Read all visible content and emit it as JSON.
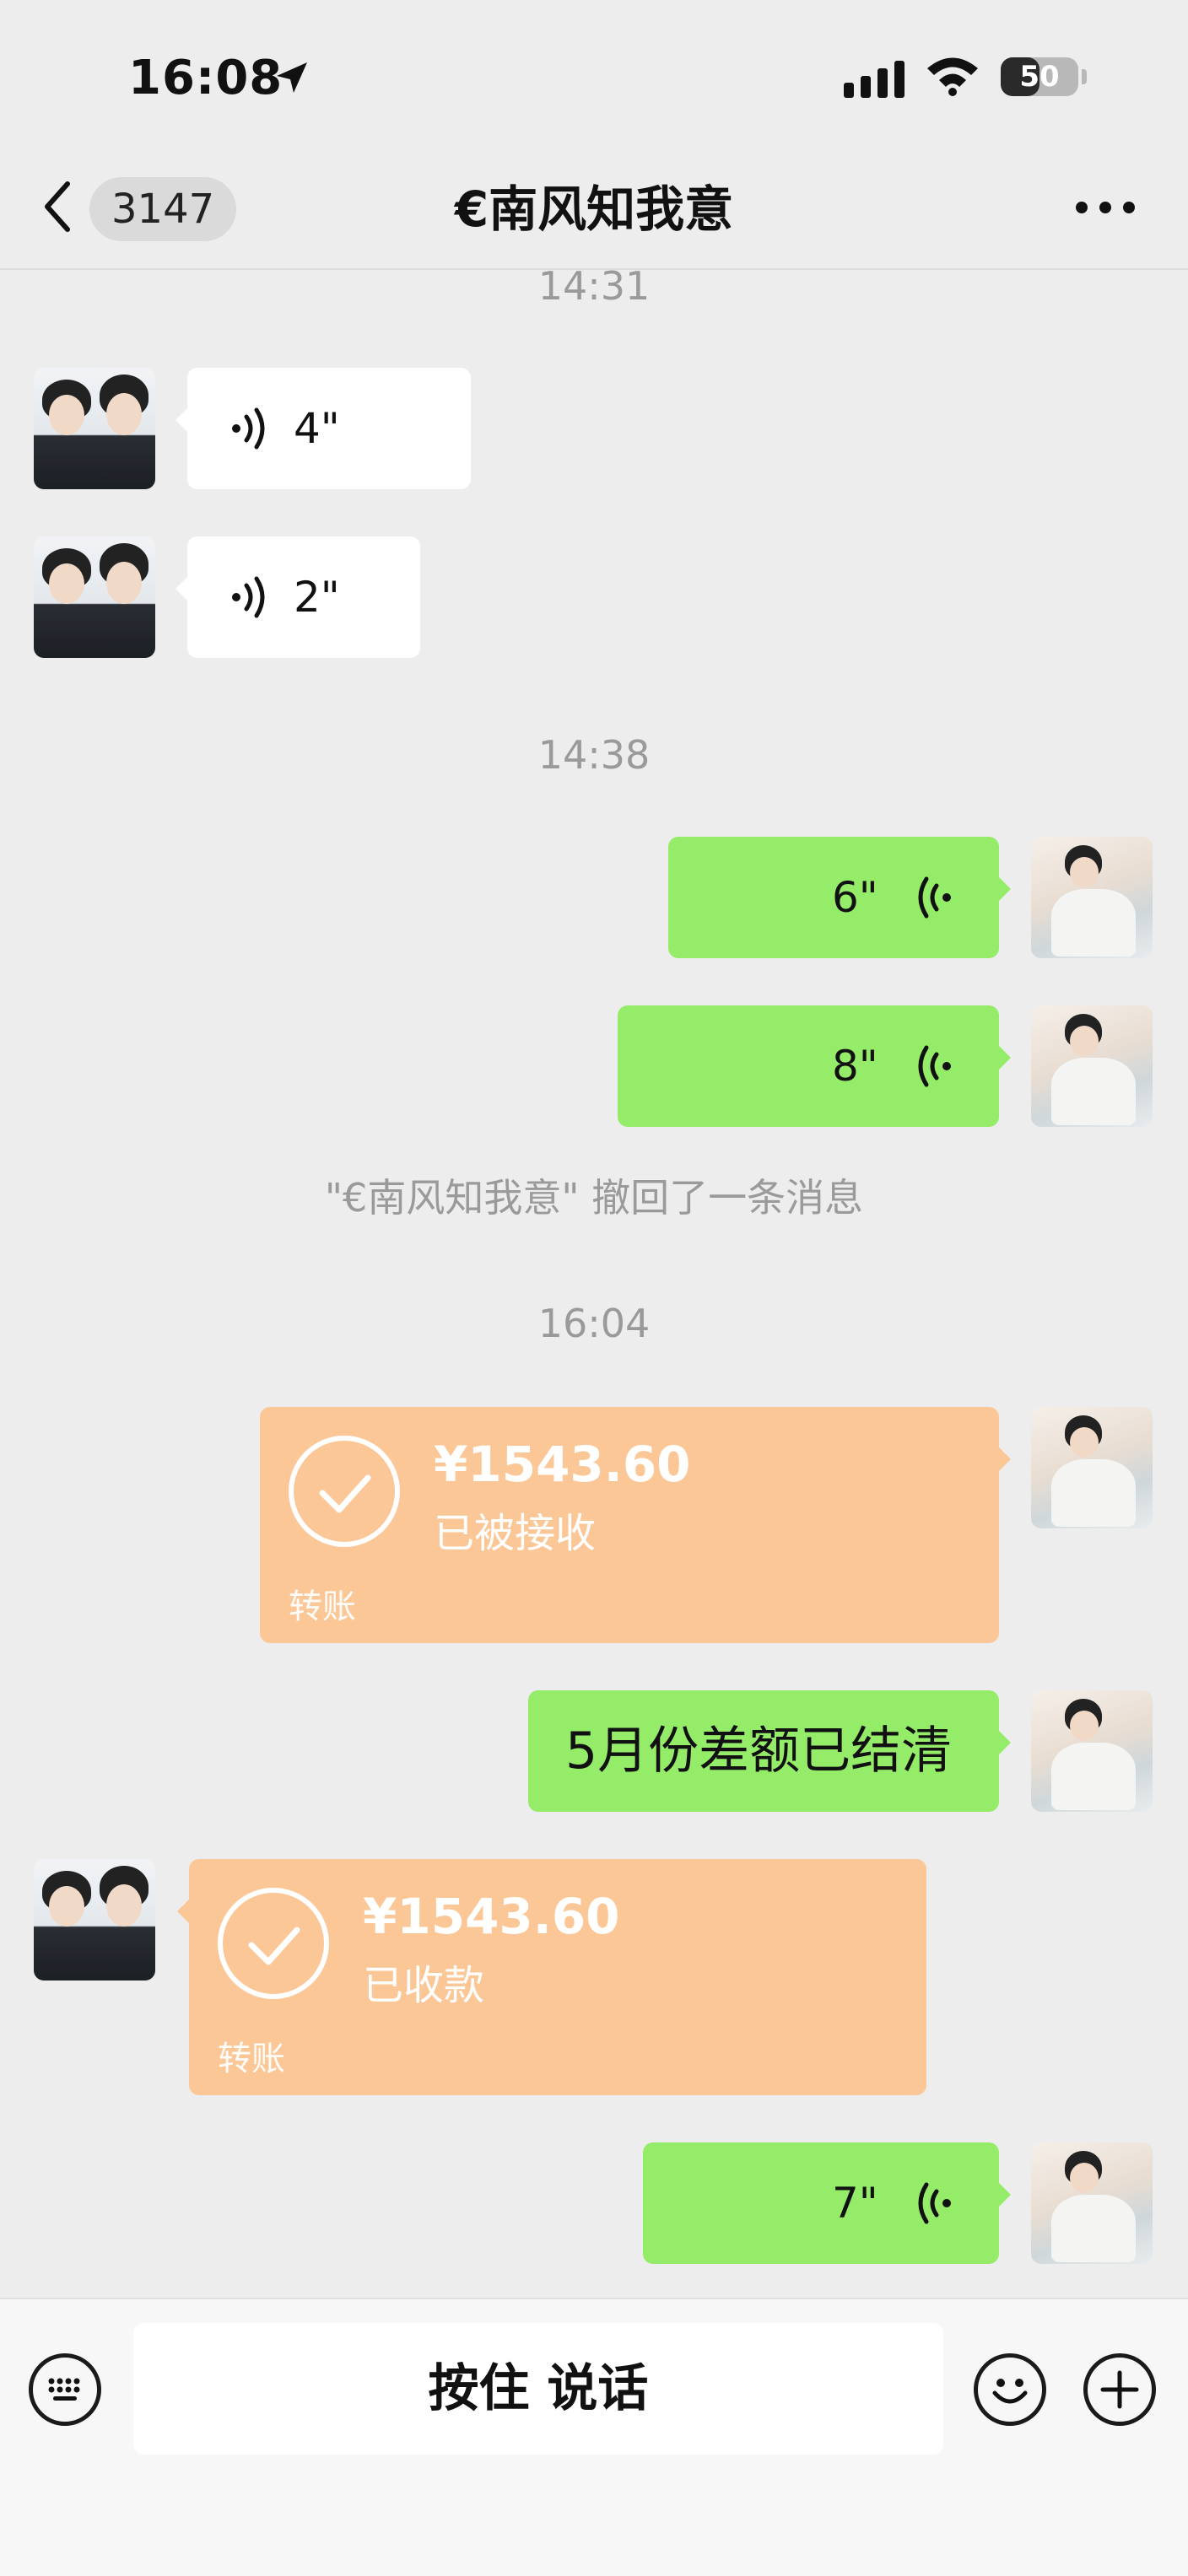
{
  "status_bar": {
    "time": "16:08",
    "battery": "50",
    "battery_level_percent": 50,
    "icons": [
      "location-arrow-icon",
      "signal-icon",
      "wifi-icon",
      "battery-icon"
    ]
  },
  "nav": {
    "back_icon": "chevron-left-icon",
    "unread_count": "3147",
    "title": "€南风知我意",
    "more_icon": "more-dots-icon"
  },
  "messages": {
    "t1": "14:31",
    "m1_duration": "4\"",
    "m2_duration": "2\"",
    "t2": "14:38",
    "m3_duration": "6\"",
    "m4_duration": "8\"",
    "recall_notice": "\"€南风知我意\" 撤回了一条消息",
    "t3": "16:04",
    "transfer1": {
      "amount": "¥1543.60",
      "status": "已被接收",
      "label": "转账"
    },
    "text1": "5月份差额已结清",
    "transfer2": {
      "amount": "¥1543.60",
      "status": "已收款",
      "label": "转账"
    },
    "m5_duration": "7\""
  },
  "input": {
    "keyboard_icon": "keyboard-icon",
    "hold_to_talk": "按住 说话",
    "emoji_icon": "emoji-icon",
    "plus_icon": "plus-icon"
  },
  "colors": {
    "background": "#ededed",
    "bubble_green": "#95ec69",
    "bubble_white": "#ffffff",
    "transfer_orange": "#fcc797",
    "timestamp_gray": "#9a9a9a"
  }
}
